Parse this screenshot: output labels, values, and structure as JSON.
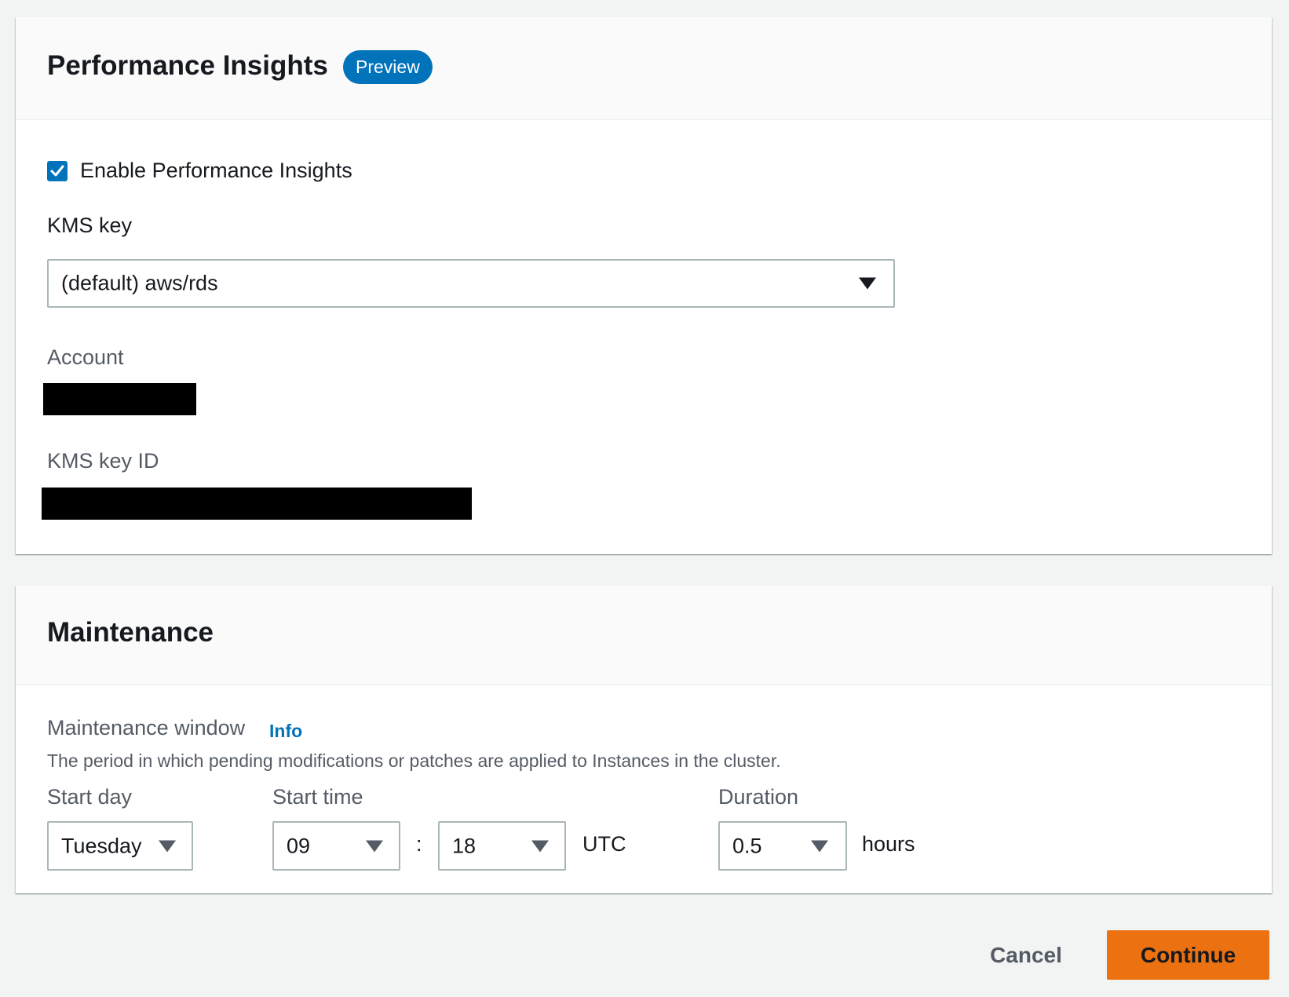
{
  "performance_insights": {
    "title": "Performance Insights",
    "badge": "Preview",
    "enable_checkbox": {
      "label": "Enable Performance Insights",
      "checked": true
    },
    "kms_key": {
      "label": "KMS key",
      "selected": "(default) aws/rds"
    },
    "account": {
      "label": "Account"
    },
    "kms_key_id": {
      "label": "KMS key ID"
    }
  },
  "maintenance": {
    "title": "Maintenance",
    "window": {
      "label": "Maintenance window",
      "info_link": "Info",
      "description": "The period in which pending modifications or patches are applied to Instances in the cluster."
    },
    "start_day": {
      "label": "Start day",
      "selected": "Tuesday"
    },
    "start_time": {
      "label": "Start time",
      "hour": "09",
      "separator": ":",
      "minute": "18",
      "timezone": "UTC"
    },
    "duration": {
      "label": "Duration",
      "selected": "0.5",
      "unit": "hours"
    }
  },
  "footer": {
    "cancel_label": "Cancel",
    "continue_label": "Continue"
  },
  "colors": {
    "accent": "#0073bb",
    "primary_button": "#ec7211",
    "background": "#f2f3f3"
  }
}
